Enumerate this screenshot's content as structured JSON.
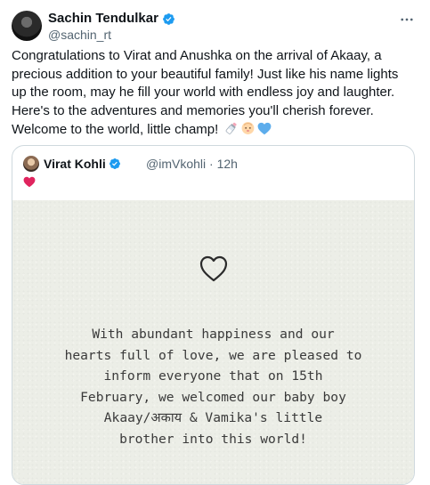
{
  "author": {
    "name": "Sachin Tendulkar",
    "handle": "@sachin_rt",
    "verified_color": "#1d9bf0"
  },
  "more_icon": "more-horizontal-icon",
  "tweet": {
    "text": "Congratulations to Virat and Anushka on the arrival of Akaay, a precious addition to your beautiful family! Just like his name lights up the room, may he fill your world with endless joy and laughter. Here's to the adventures and memories you'll cherish forever. Welcome to the world, little champ!",
    "emojis": [
      "baby-bottle-icon",
      "baby-icon",
      "blue-heart-icon"
    ]
  },
  "quoted_tweet": {
    "name": "Virat Kohli",
    "handle": "@imVkohli",
    "separator": "·",
    "time": "12h",
    "emoji": "red-heart-icon",
    "card": {
      "background": "#eceee7",
      "message": "With abundant happiness and our\nhearts full of love, we are pleased to\ninform everyone that on 15th\nFebruary, we welcomed our baby boy\nAkaay/अकाय & Vamika's little\nbrother into this world!"
    }
  }
}
